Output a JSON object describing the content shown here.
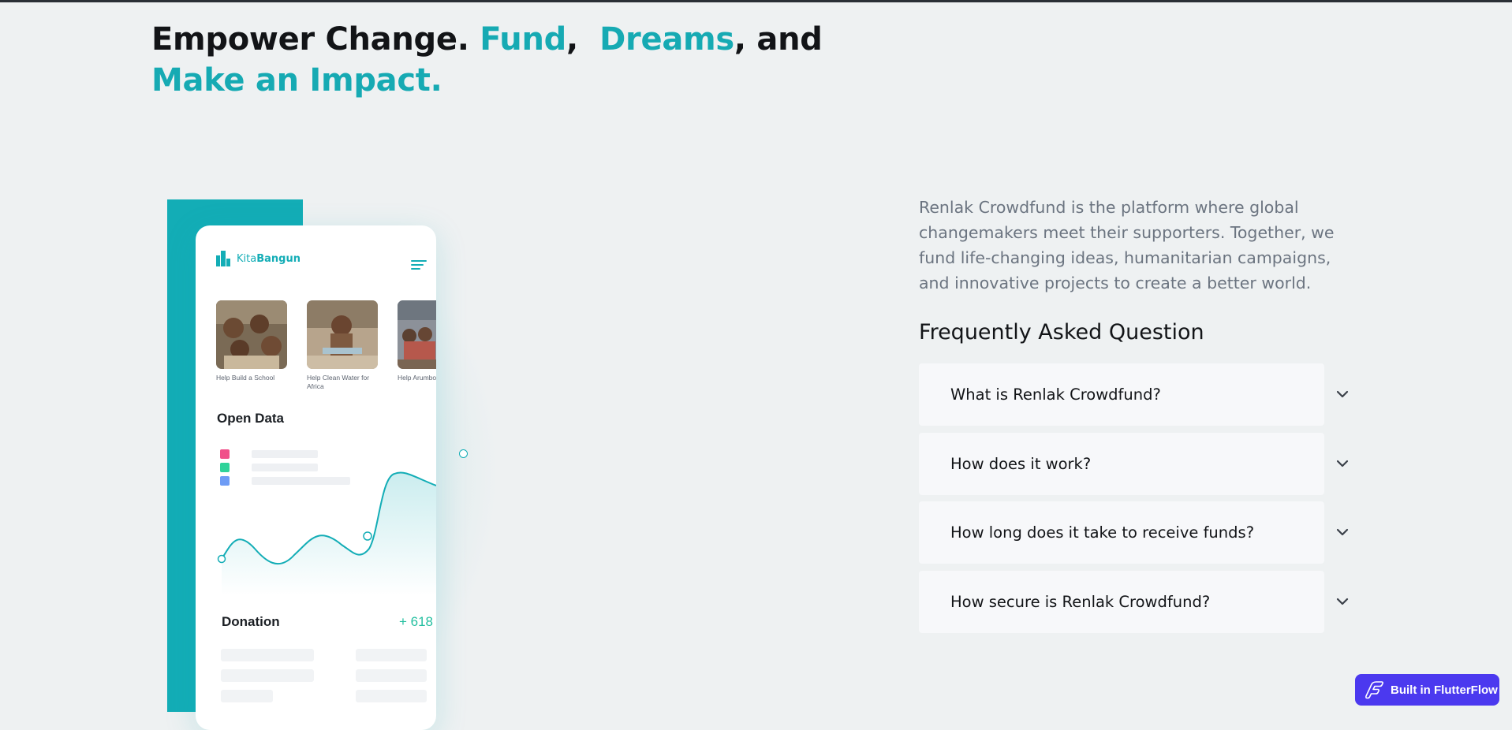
{
  "hero": {
    "part1": "Empower Change.",
    "fund": "Fund",
    "comma": ",",
    "dreams": "Dreams",
    "and": ", and",
    "impact": "Make an Impact."
  },
  "phone": {
    "logo_prefix": "Kita",
    "logo_suffix": "Bangun",
    "thumbnails": [
      {
        "caption": "Help Build a School"
      },
      {
        "caption": "Help Clean Water for Africa"
      },
      {
        "caption": "Help Arumbo"
      }
    ],
    "open_data_title": "Open Data",
    "legend_colors": [
      "#f0508a",
      "#2fd39a",
      "#6e9cf5"
    ],
    "donation_label": "Donation",
    "donation_value": "+ 618",
    "accent": "#13adb6"
  },
  "intro": "Renlak Crowdfund is the platform where global changemakers meet their supporters. Together, we fund life-changing ideas, humanitarian campaigns, and innovative projects to create a better world.",
  "faq": {
    "title": "Frequently Asked Question",
    "items": [
      {
        "question": "What is Renlak Crowdfund?"
      },
      {
        "question": "How does it work?"
      },
      {
        "question": "How long does it take to receive funds?"
      },
      {
        "question": "How secure is Renlak Crowdfund?"
      }
    ]
  },
  "badge": {
    "label": "Built in FlutterFlow",
    "color": "#4b39ef"
  }
}
